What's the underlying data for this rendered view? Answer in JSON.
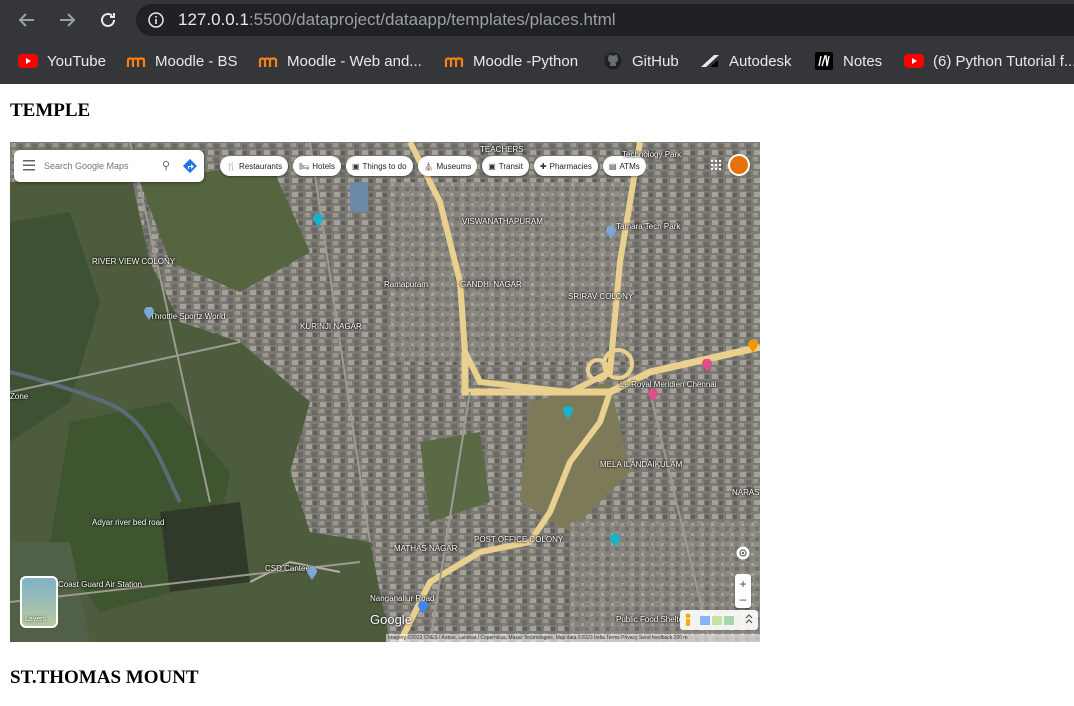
{
  "browser": {
    "url_host": "127.0.0.1",
    "url_rest": ":5500/dataproject/dataapp/templates/places.html",
    "bookmarks": [
      {
        "label": "YouTube",
        "icon": "youtube-icon"
      },
      {
        "label": "Moodle - BS",
        "icon": "moodle-icon"
      },
      {
        "label": "Moodle - Web and...",
        "icon": "moodle-icon"
      },
      {
        "label": "Moodle -Python",
        "icon": "moodle-icon"
      },
      {
        "label": "GitHub",
        "icon": "github-icon"
      },
      {
        "label": "Autodesk",
        "icon": "autodesk-icon"
      },
      {
        "label": "Notes",
        "icon": "notes-icon"
      },
      {
        "label": "(6) Python Tutorial f...",
        "icon": "youtube-icon"
      }
    ]
  },
  "page": {
    "heading_1": "TEMPLE",
    "heading_2": "ST.THOMAS MOUNT"
  },
  "map": {
    "search_placeholder": "Search Google Maps",
    "chips": [
      "Restaurants",
      "Hotels",
      "Things to do",
      "Museums",
      "Transit",
      "Pharmacies",
      "ATMs"
    ],
    "labels": {
      "gandhi_nagar": "GANDHI NAGAR",
      "kurinji_nagar": "KURINJI NAGAR",
      "throttle": "Throttle Sportz World",
      "river_view": "RIVER VIEW COLONY",
      "teachers": "TEACHERS",
      "vishwanathapuram": "VISWANATHAPURAM",
      "technology_park": "Technology Park",
      "tamara": "Tamara Tech Park",
      "mela": "MELA ILANDAIKULAM",
      "le_royal": "Le Royal Meridien Chennai",
      "post_office": "POST OFFICE COLONY",
      "csd": "CSD Canteen",
      "mathas": "MATHAS NAGAR",
      "adyar": "Adyar river bed road",
      "coast_guard": "Coast Guard Air Station",
      "nanganallur": "Nanganallur Road",
      "food": "Public Food Shelter",
      "narasimha": "NARAS COLO",
      "srirav": "SRIRAV COLONY",
      "zone": "Zone",
      "ramapuram": "Ramapuram"
    },
    "layers_label": "Layers",
    "logo": "Google",
    "attribution": "Imagery ©2023 CNES / Airbus, Landsat / Copernicus, Maxar Technologies, Map data ©2023   India   Terms   Privacy   Send feedback   200 m"
  }
}
